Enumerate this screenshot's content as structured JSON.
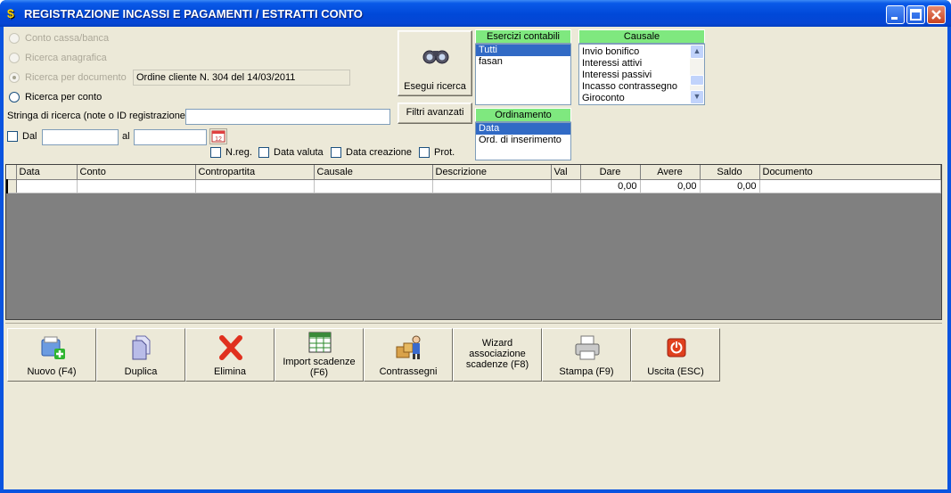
{
  "window": {
    "title": "REGISTRAZIONE INCASSI E PAGAMENTI / ESTRATTI CONTO"
  },
  "search": {
    "radio_conto_cassa": "Conto cassa/banca",
    "radio_anagrafica": "Ricerca anagrafica",
    "radio_documento": "Ricerca per documento",
    "documento_value": "Ordine cliente N. 304 del 14/03/2011",
    "radio_conto": "Ricerca per conto",
    "stringa_label": "Stringa di ricerca (note o ID registrazione)",
    "stringa_value": "",
    "dal_label": "Dal",
    "dal_value": "",
    "al_label": "al",
    "al_value": "",
    "calendar_day": "12",
    "chk_nreg": "N.reg.",
    "chk_data_valuta": "Data valuta",
    "chk_data_creazione": "Data creazione",
    "chk_prot": "Prot."
  },
  "buttons": {
    "esegui_ricerca": "Esegui ricerca",
    "filtri_avanzati": "Filtri avanzati"
  },
  "esercizi": {
    "header": "Esercizi contabili",
    "items": [
      "Tutti",
      "fasan"
    ],
    "selected": "Tutti"
  },
  "ordinamento": {
    "header": "Ordinamento",
    "items": [
      "Data",
      "Ord. di inserimento"
    ],
    "selected": "Data"
  },
  "causale": {
    "header": "Causale",
    "items": [
      "Invio bonifico",
      "Interessi attivi",
      "Interessi passivi",
      "Incasso contrassegno",
      "Giroconto"
    ]
  },
  "grid": {
    "columns": [
      "Data",
      "Conto",
      "Contropartita",
      "Causale",
      "Descrizione",
      "Val",
      "Dare",
      "Avere",
      "Saldo",
      "Documento"
    ],
    "rows": [
      [
        "",
        "",
        "",
        "",
        "",
        "",
        "0,00",
        "0,00",
        "0,00",
        ""
      ]
    ]
  },
  "toolbar": {
    "nuovo": "Nuovo (F4)",
    "duplica": "Duplica",
    "elimina": "Elimina",
    "import": "Import scadenze (F6)",
    "contrassegni": "Contrassegni",
    "wizard": "Wizard associazione scadenze (F8)",
    "stampa": "Stampa (F9)",
    "uscita": "Uscita (ESC)"
  },
  "colors": {
    "title_bar": "#0048d8",
    "list_header": "#7fe87f",
    "selection": "#316ac5",
    "grid_bg": "#808080"
  }
}
